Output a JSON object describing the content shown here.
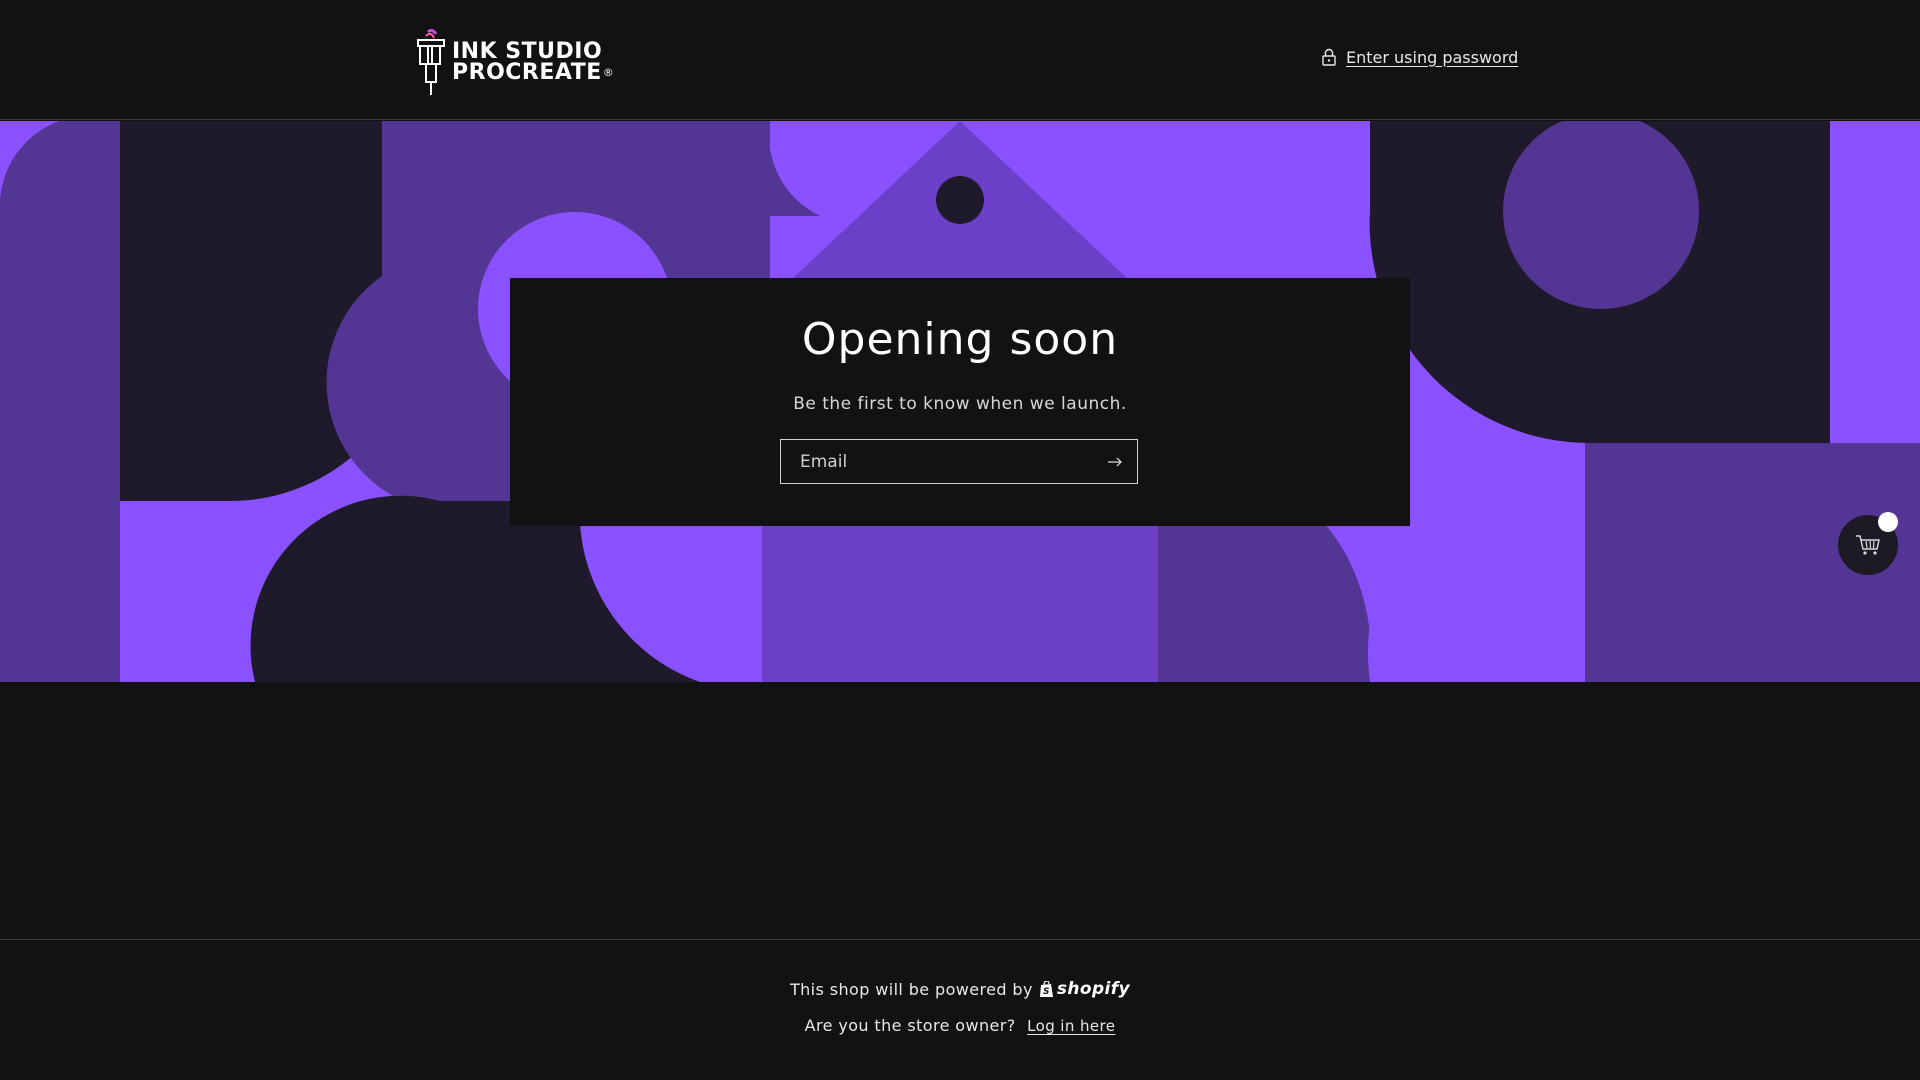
{
  "header": {
    "logo": {
      "line1": "INK STUDIO",
      "line2": "PROCREATE"
    },
    "password_link": "Enter using password"
  },
  "banner": {
    "colors": {
      "violet": "#8a52ff",
      "mid": "#6b3fc8",
      "deep": "#533593",
      "dark": "#1e1a2b"
    }
  },
  "card": {
    "title": "Opening soon",
    "subtitle": "Be the first to know when we launch.",
    "email_placeholder": "Email",
    "submit_icon": "arrow-right-icon"
  },
  "cart": {
    "icon": "cart-icon",
    "count": ""
  },
  "footer": {
    "powered_text": "This shop will be powered by",
    "shopify": "shopify",
    "owner_text": "Are you the store owner?",
    "login_link": "Log in here"
  }
}
